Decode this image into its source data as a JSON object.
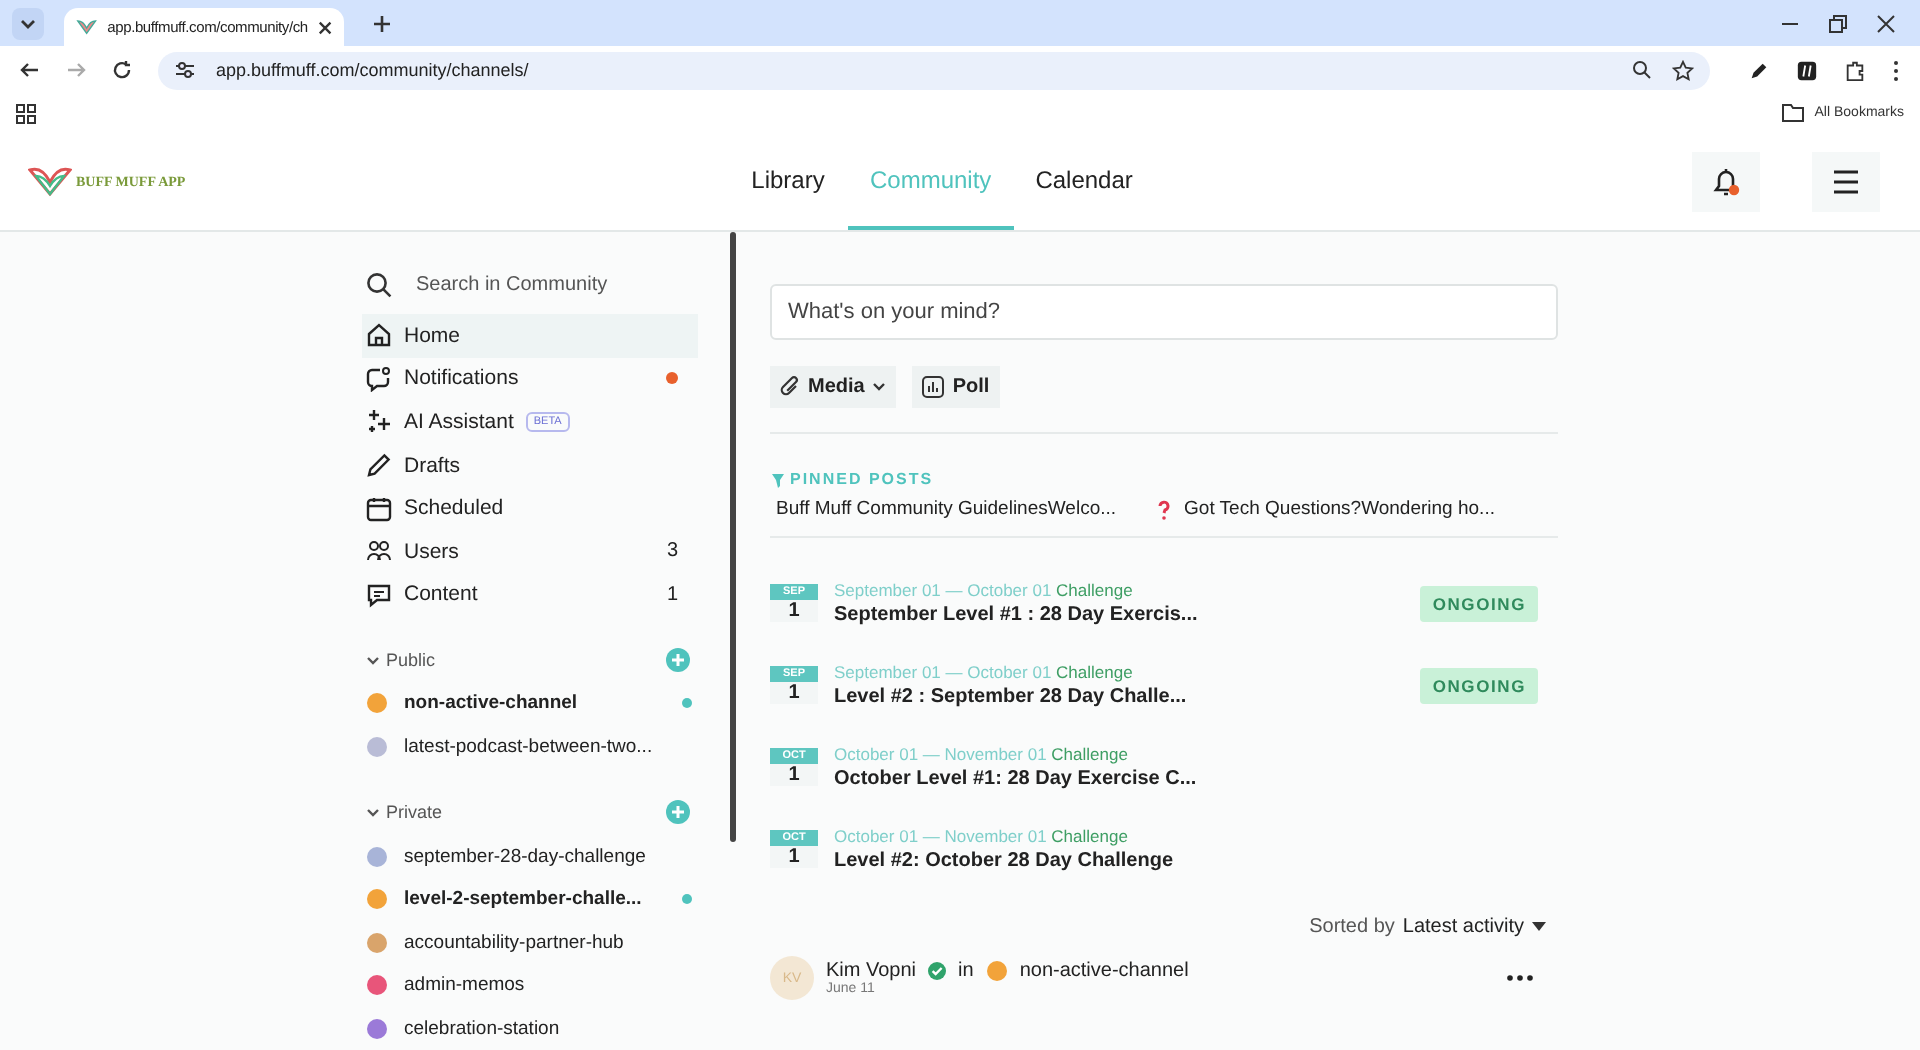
{
  "browser": {
    "tab_title": "app.buffmuff.com/community/ch",
    "url": "app.buffmuff.com/community/channels/",
    "bookmarks_label": "All Bookmarks"
  },
  "header": {
    "logo_text": "BUFF MUFF APP",
    "nav": [
      {
        "label": "Library",
        "selected": false
      },
      {
        "label": "Community",
        "selected": true
      },
      {
        "label": "Calendar",
        "selected": false
      }
    ],
    "notifications_unread": true
  },
  "sidebar": {
    "search": {
      "placeholder": "Search in Community"
    },
    "items": [
      {
        "label": "Home",
        "selected": true,
        "unread": false
      },
      {
        "label": "Notifications",
        "selected": false,
        "unread": true
      },
      {
        "label": "AI Assistant",
        "selected": false,
        "unread": false,
        "badge": "BETA"
      },
      {
        "label": "Drafts",
        "selected": false,
        "unread": false
      },
      {
        "label": "Scheduled",
        "selected": false,
        "unread": false
      },
      {
        "label": "Users",
        "selected": false,
        "unread": false,
        "count": "3"
      },
      {
        "label": "Content",
        "selected": false,
        "unread": false,
        "count": "1"
      }
    ],
    "groups": [
      {
        "label": "Public",
        "expanded": true,
        "channels": [
          {
            "name": "non-active-channel",
            "unread": true
          },
          {
            "name": "latest-podcast-between-two...",
            "unread": false
          }
        ]
      },
      {
        "label": "Private",
        "expanded": true,
        "channels": [
          {
            "name": "september-28-day-challenge",
            "unread": false
          },
          {
            "name": "level-2-september-challe...",
            "unread": true
          },
          {
            "name": "accountability-partner-hub",
            "unread": false
          },
          {
            "name": "admin-memos",
            "unread": false
          },
          {
            "name": "celebration-station",
            "unread": false
          }
        ]
      }
    ]
  },
  "composer": {
    "placeholder": "What's on your mind?",
    "buttons": [
      {
        "label": "Media",
        "dropdown": true
      },
      {
        "label": "Poll",
        "dropdown": false
      }
    ]
  },
  "pinned": {
    "title": "PINNED POSTS",
    "posts": [
      "Buff Muff Community GuidelinesWelco...",
      "Got Tech Questions?Wondering ho..."
    ]
  },
  "events": [
    {
      "month": "SEP",
      "day": "1",
      "dates": "September 01 — October 01",
      "type": "Challenge",
      "title": "September Level #1 : 28 Day Exercis...",
      "status": "ONGOING"
    },
    {
      "month": "SEP",
      "day": "1",
      "dates": "September 01 — October 01",
      "type": "Challenge",
      "title": "Level #2 : September 28 Day Challe...",
      "status": "ONGOING"
    },
    {
      "month": "OCT",
      "day": "1",
      "dates": "October 01 — November 01",
      "type": "Challenge",
      "title": "October Level #1: 28 Day Exercise C..."
    },
    {
      "month": "OCT",
      "day": "1",
      "dates": "October 01 — November 01",
      "type": "Challenge",
      "title": "Level #2: October 28 Day Challenge"
    }
  ],
  "sort": {
    "prefix": "Sorted by",
    "value": "Latest activity"
  },
  "post": {
    "avatar_initials": "KV",
    "author": "Kim Vopni",
    "verified": true,
    "in": "in",
    "channel": "non-active-channel",
    "date": "June 11"
  }
}
